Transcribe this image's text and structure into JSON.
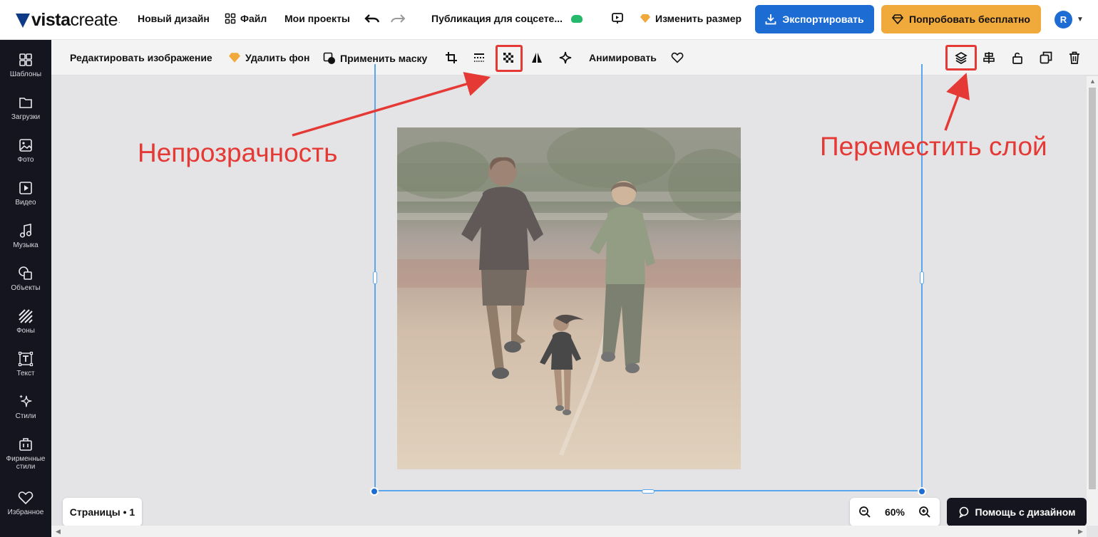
{
  "header": {
    "logo_bold": "vista",
    "logo_regular": "create",
    "new_design": "Новый дизайн",
    "file": "Файл",
    "my_projects": "Мои проекты",
    "doc_title": "Публикация для соцсете...",
    "resize": "Изменить размер",
    "export": "Экспортировать",
    "try_free": "Попробовать бесплатно",
    "avatar_letter": "R"
  },
  "sidebar": {
    "items": [
      {
        "label": "Шаблоны",
        "icon": "templates-icon"
      },
      {
        "label": "Загрузки",
        "icon": "folder-icon"
      },
      {
        "label": "Фото",
        "icon": "photo-icon"
      },
      {
        "label": "Видео",
        "icon": "video-icon"
      },
      {
        "label": "Музыка",
        "icon": "music-icon"
      },
      {
        "label": "Объекты",
        "icon": "shapes-icon"
      },
      {
        "label": "Фоны",
        "icon": "backgrounds-icon"
      },
      {
        "label": "Текст",
        "icon": "text-icon"
      },
      {
        "label": "Стили",
        "icon": "sparkle-icon"
      },
      {
        "label": "Фирменные стили",
        "icon": "brand-kit-icon"
      },
      {
        "label": "Избранное",
        "icon": "heart-icon"
      }
    ]
  },
  "toolbar": {
    "edit_image": "Редактировать изображение",
    "remove_bg": "Удалить фон",
    "apply_mask": "Применить маску",
    "animate": "Анимировать"
  },
  "annotations": {
    "opacity": "Непрозрачность",
    "move_layer": "Переместить слой"
  },
  "footer": {
    "pages": "Страницы • 1",
    "zoom": "60%",
    "help": "Помощь с дизайном"
  },
  "colors": {
    "accent_blue": "#1c6cd4",
    "try_orange": "#f0a93b",
    "annotation_red": "#e53935",
    "sidebar_bg": "#15151f"
  }
}
